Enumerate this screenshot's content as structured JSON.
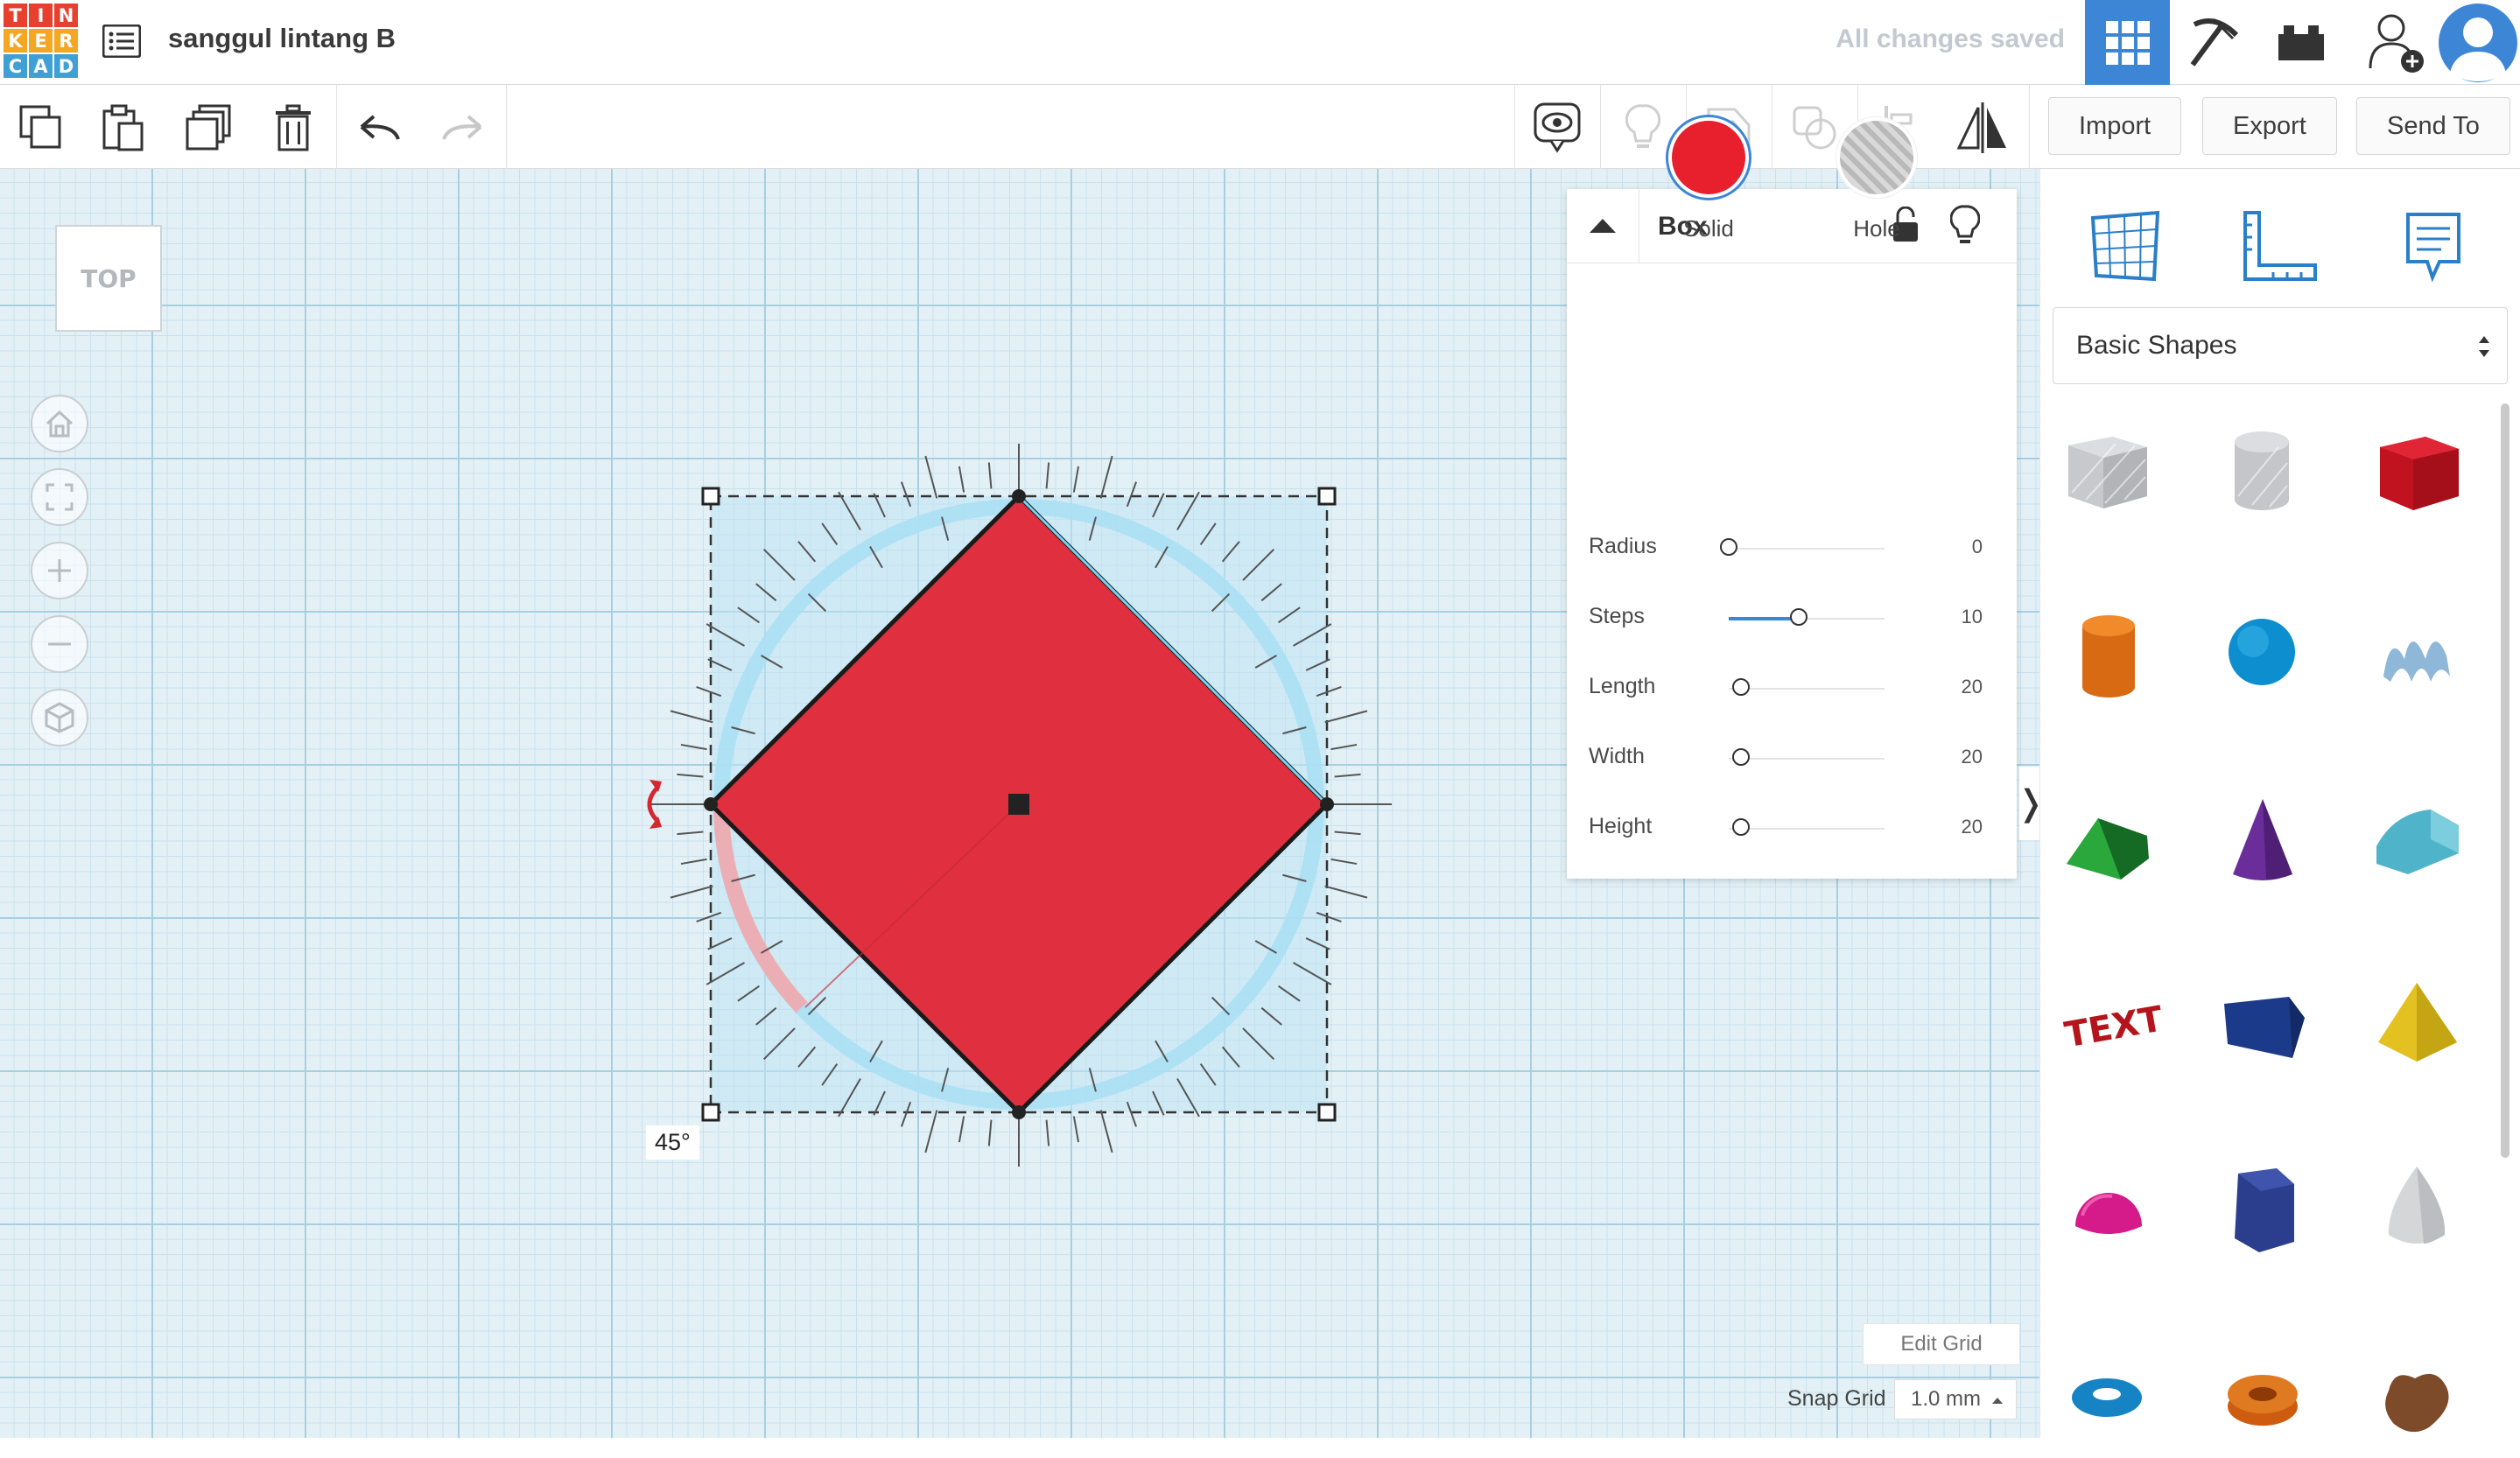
{
  "app": {
    "logo_letters": [
      "T",
      "I",
      "N",
      "K",
      "E",
      "R",
      "C",
      "A",
      "D"
    ],
    "logo_colors": [
      "#e8402e",
      "#e8402e",
      "#e8402e",
      "#f5a623",
      "#f5a623",
      "#f5a623",
      "#3fa0d6",
      "#3fa0d6",
      "#3fa0d6"
    ],
    "design_title": "sanggul lintang B",
    "save_status": "All changes saved",
    "accent": "#3d86d6"
  },
  "toolbar": {
    "import_label": "Import",
    "export_label": "Export",
    "send_to_label": "Send To"
  },
  "workplane": {
    "view_cube_label": "TOP",
    "rotation_angle": "45°",
    "shape_color": "#e03040"
  },
  "inspector": {
    "title": "Box",
    "solid_label": "Solid",
    "hole_label": "Hole",
    "solid_color": "#e8202e",
    "params": [
      {
        "label": "Radius",
        "value": "0",
        "fraction": 0.0
      },
      {
        "label": "Steps",
        "value": "10",
        "fraction": 0.45
      },
      {
        "label": "Length",
        "value": "20",
        "fraction": 0.08
      },
      {
        "label": "Width",
        "value": "20",
        "fraction": 0.08
      },
      {
        "label": "Height",
        "value": "20",
        "fraction": 0.08
      }
    ]
  },
  "grid": {
    "edit_grid_label": "Edit Grid",
    "snap_grid_label": "Snap Grid",
    "snap_grid_value": "1.0 mm"
  },
  "library": {
    "selected": "Basic Shapes",
    "shapes": [
      "box-hole-icon",
      "cylinder-hole-icon",
      "box-icon",
      "cylinder-icon",
      "sphere-icon",
      "scribble-icon",
      "roof-icon",
      "cone-icon",
      "round-roof-icon",
      "text-icon",
      "polygon-icon",
      "pyramid-icon",
      "half-sphere-icon",
      "hexagonal-prism-icon",
      "paraboloid-icon",
      "torus-icon",
      "tube-icon",
      "heart-icon"
    ]
  }
}
